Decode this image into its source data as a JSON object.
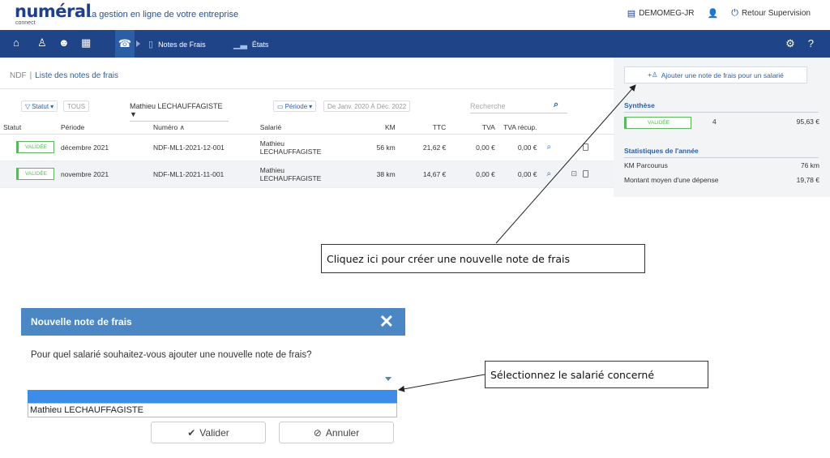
{
  "header": {
    "logo_word": "numéral",
    "logo_sub": "connect",
    "tagline": "La gestion en ligne de votre entreprise",
    "company": "DEMOMEG-JR",
    "retour": "Retour Supervision"
  },
  "nav": {
    "tab_notes": "Notes de Frais",
    "tab_etats": "États"
  },
  "breadcrumb": {
    "root": "NDF",
    "sep": "|",
    "current": "Liste des notes de frais"
  },
  "filters": {
    "statut": "Statut",
    "tous": "TOUS",
    "employee": "Mathieu LECHAUFFAGISTE",
    "periode": "Période",
    "range": "De Janv. 2020 À Déc. 2022",
    "search_placeholder": "Recherche"
  },
  "table": {
    "headers": [
      "Statut",
      "Période",
      "Numéro",
      "Salarié",
      "KM",
      "TTC",
      "TVA",
      "TVA récup."
    ],
    "rows": [
      {
        "statut": "VALIDÉE",
        "periode": "décembre 2021",
        "numero": "NDF-ML1-2021-12-001",
        "salarie_first": "Mathieu",
        "salarie_last": "LECHAUFFAGISTE",
        "km": "56 km",
        "ttc": "21,62 €",
        "tva": "0,00 €",
        "tva_recup": "0,00 €"
      },
      {
        "statut": "VALIDÉE",
        "periode": "novembre 2021",
        "numero": "NDF-ML1-2021-11-001",
        "salarie_first": "Mathieu",
        "salarie_last": "LECHAUFFAGISTE",
        "km": "38 km",
        "ttc": "14,67 €",
        "tva": "0,00 €",
        "tva_recup": "0,00 €"
      }
    ]
  },
  "side": {
    "add_label": "Ajouter une note de frais pour un salarié",
    "synthese_title": "Synthèse",
    "synthese_badge": "VALIDÉE",
    "synthese_count": "4",
    "synthese_total": "95,63 €",
    "stats_title": "Statistiques de l'année",
    "km_label": "KM Parcourus",
    "km_value": "76 km",
    "avg_label": "Montant moyen d'une dépense",
    "avg_value": "19,78 €"
  },
  "callouts": {
    "create": "Cliquez ici pour créer une nouvelle note de frais",
    "select": "Sélectionnez le salarié concerné"
  },
  "modal": {
    "title": "Nouvelle note de frais",
    "close": "✕",
    "question": "Pour quel salarié souhaitez-vous ajouter une nouvelle note de frais?",
    "option": "Mathieu LECHAUFFAGISTE",
    "validate": "Valider",
    "cancel": "Annuler"
  }
}
